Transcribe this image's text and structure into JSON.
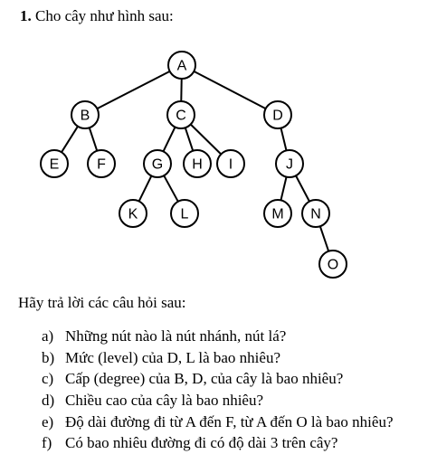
{
  "problem": {
    "number": "1.",
    "title": "Cho cây như hình sau:"
  },
  "tree": {
    "nodes": [
      "A",
      "B",
      "C",
      "D",
      "E",
      "F",
      "G",
      "H",
      "I",
      "J",
      "K",
      "L",
      "M",
      "N",
      "O"
    ],
    "edges": [
      [
        "A",
        "B"
      ],
      [
        "A",
        "C"
      ],
      [
        "A",
        "D"
      ],
      [
        "B",
        "E"
      ],
      [
        "B",
        "F"
      ],
      [
        "C",
        "G"
      ],
      [
        "C",
        "H"
      ],
      [
        "C",
        "I"
      ],
      [
        "D",
        "J"
      ],
      [
        "G",
        "K"
      ],
      [
        "G",
        "L"
      ],
      [
        "J",
        "M"
      ],
      [
        "J",
        "N"
      ],
      [
        "N",
        "O"
      ]
    ]
  },
  "intro": "Hãy trả lời các câu hỏi sau:",
  "questions": [
    {
      "letter": "a)",
      "text": "Những nút nào là nút nhánh, nút lá?"
    },
    {
      "letter": "b)",
      "text": "Mức (level) của D, L là bao nhiêu?"
    },
    {
      "letter": "c)",
      "text": "Cấp (degree) của B, D, của cây là bao nhiêu?"
    },
    {
      "letter": "d)",
      "text": "Chiều cao của cây là bao nhiêu?"
    },
    {
      "letter": "e)",
      "text": "Độ dài đường đi từ A đến F, từ A đến O là bao nhiêu?"
    },
    {
      "letter": "f)",
      "text": "Có bao nhiêu đường đi có độ dài 3 trên cây?"
    }
  ]
}
